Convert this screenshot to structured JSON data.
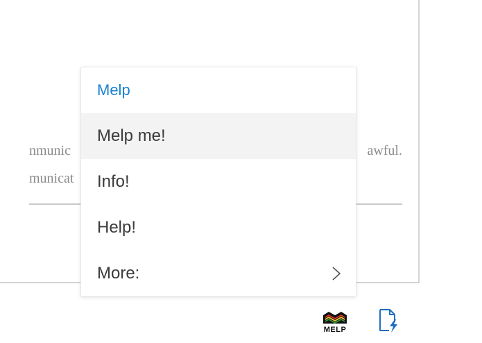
{
  "background_document": {
    "line1_left": "nmunic",
    "line1_right": "awful.",
    "line2_left": "municat"
  },
  "menu": {
    "header": "Melp",
    "items": [
      {
        "label": "Melp me!",
        "highlighted": true
      },
      {
        "label": "Info!"
      },
      {
        "label": "Help!"
      },
      {
        "label": "More:",
        "has_submenu": true,
        "submenu_icon": "chevron-right-icon"
      }
    ]
  },
  "toolbar": {
    "logo_text": "MELP",
    "logo_icon": "melp-logo-icon",
    "doc_icon": "document-lightning-icon"
  },
  "colors": {
    "accent": "#1a82d1",
    "hover_bg": "#f3f3f3",
    "logo_red": "#d9332b",
    "logo_yellow": "#f2c230",
    "logo_green": "#2f9a3a"
  }
}
